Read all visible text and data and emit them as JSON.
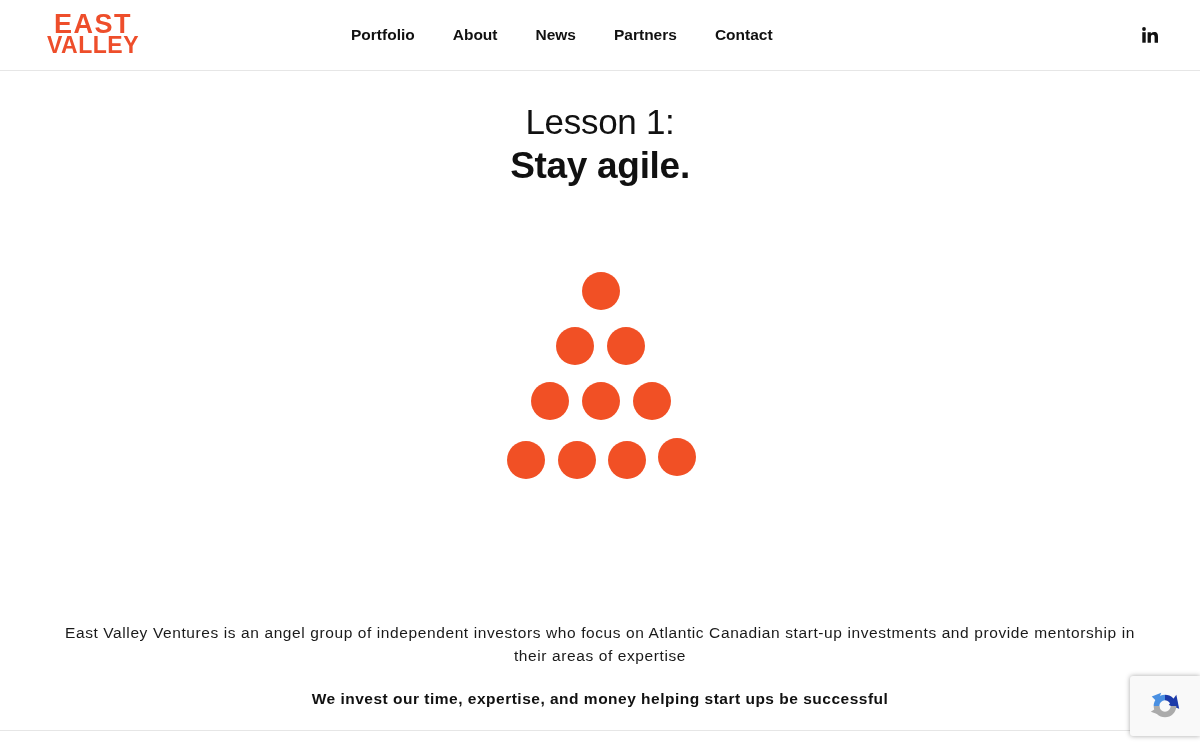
{
  "logo": {
    "lines": [
      "EAST",
      "VALLEY"
    ]
  },
  "nav": [
    {
      "label": "Portfolio"
    },
    {
      "label": "About"
    },
    {
      "label": "News"
    },
    {
      "label": "Partners"
    },
    {
      "label": "Contact"
    }
  ],
  "hero": {
    "kicker": "Lesson 1:",
    "title": "Stay agile."
  },
  "intro": {
    "text": "East Valley Ventures is an angel group of independent investors who focus on Atlantic Canadian start-up investments and provide mentorship in their areas of expertise",
    "tagline": "We invest our time, expertise, and money helping start ups be successful"
  }
}
